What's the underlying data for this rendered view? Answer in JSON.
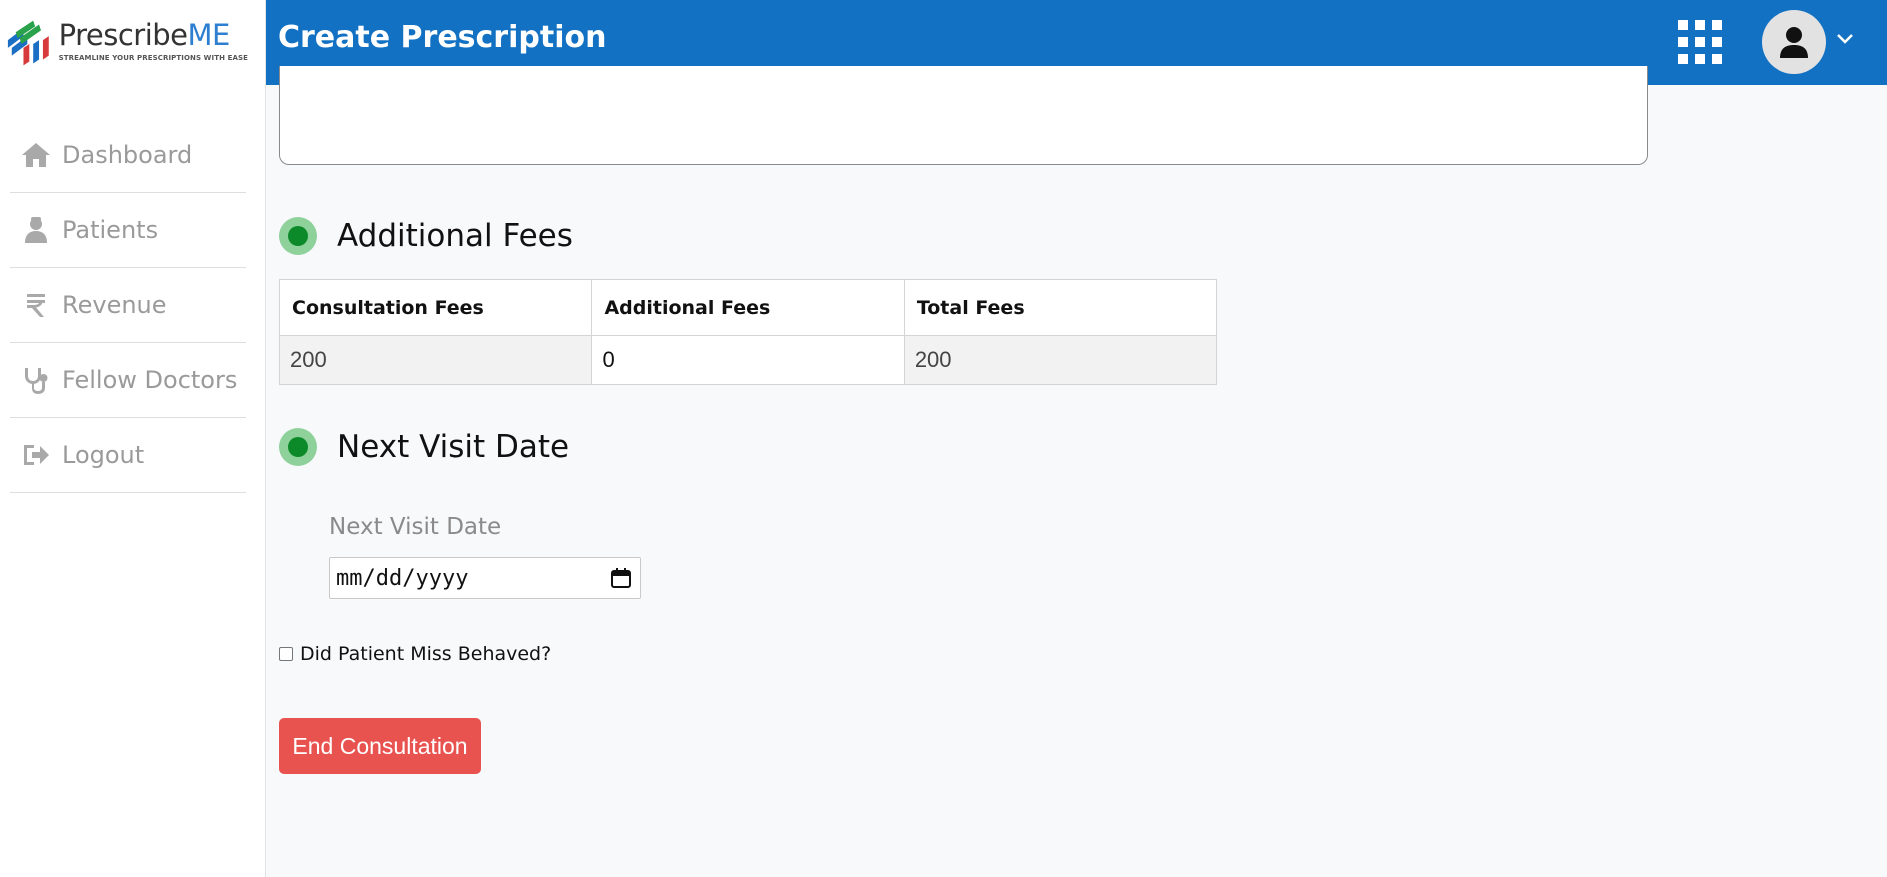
{
  "app": {
    "brand_main": "Prescribe",
    "brand_accent": "ME",
    "tagline": "STREAMLINE YOUR PRESCRIPTIONS WITH EASE",
    "brand_color": "#1271c2"
  },
  "sidebar": {
    "items": [
      {
        "label": "Dashboard",
        "icon": "home-icon"
      },
      {
        "label": "Patients",
        "icon": "user-doctor-icon"
      },
      {
        "label": "Revenue",
        "icon": "rupee-icon"
      },
      {
        "label": "Fellow Doctors",
        "icon": "stethoscope-icon"
      },
      {
        "label": "Logout",
        "icon": "logout-icon"
      }
    ]
  },
  "header": {
    "title": "Create Prescription"
  },
  "additional_fees": {
    "title": "Additional Fees",
    "columns": [
      "Consultation Fees",
      "Additional Fees",
      "Total Fees"
    ],
    "row": {
      "consultation": "200",
      "additional": "0",
      "total": "200"
    }
  },
  "next_visit": {
    "title": "Next Visit Date",
    "label": "Next Visit Date",
    "placeholder": "mm/dd/yyyy"
  },
  "misbehaved": {
    "label": "Did Patient Miss Behaved?",
    "checked": false
  },
  "actions": {
    "end_label": "End Consultation",
    "end_color": "#e85350"
  }
}
